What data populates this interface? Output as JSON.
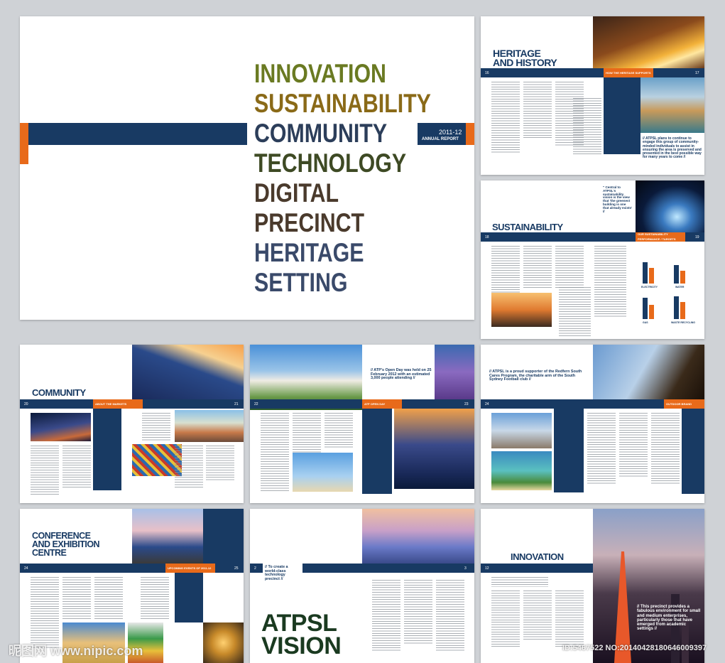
{
  "cover": {
    "words": [
      "INNOVATION",
      "SUSTAINABILITY",
      "COMMUNITY",
      "TECHNOLOGY",
      "DIGITAL PRECINCT",
      "HERITAGE SETTING"
    ],
    "year": "2011-12",
    "report": "ANNUAL REPORT"
  },
  "heritage": {
    "title_1": "HERITAGE",
    "title_2": "AND HISTORY",
    "page_left": "16",
    "page_right": "17",
    "orange_label": "HOW THE HERITAGE SUPPORTS US",
    "quote": "// ATPSL plans to continue to engage this group of community-minded individuals to assist in ensuring the area is preserved and presented in the best possible way for many years to come //"
  },
  "sustainability": {
    "title": "SUSTAINABILITY",
    "page_left": "18",
    "page_right": "19",
    "quote": "\" Central to ATPSL's sustainability vision is the view that 'the greenest building is one that already exists' //",
    "orange_label": "OUR SUSTAINABILITY PERFORMANCE / TARGETS",
    "chart_labels": [
      "ELECTRICITY",
      "WATER",
      "GAS",
      "WASTE RECYCLING"
    ]
  },
  "community": {
    "title": "COMMUNITY",
    "page_left": "20",
    "page_right": "21",
    "orange_label": "ABOUT THE MARKETS"
  },
  "openday": {
    "page_left": "22",
    "page_right": "23",
    "quote": "// ATP's Open Day was held on 25 February 2012 with an estimated 3,000 people attending //",
    "orange_label": "ATP OPEN DAY"
  },
  "football": {
    "page_left": "24",
    "page_right": "25",
    "quote": "// ATPSL is a proud supporter of the Redfern South Cares Program, the charitable arm of the South Sydney Football club //",
    "orange_label": "OUTDOOR BRAND"
  },
  "conference": {
    "title_1": "CONFERENCE",
    "title_2": "AND EXHIBITION",
    "title_3": "CENTRE",
    "page_left": "24",
    "page_right": "25",
    "orange_label": "UPCOMING EVENTS OF 2011-12"
  },
  "vision": {
    "page_left": "2",
    "page_right": "3",
    "quote": "// To create a world-class technology precinct //",
    "title_1": "ATPSL",
    "title_2": "VISION"
  },
  "innovation": {
    "title": "INNOVATION",
    "page_left": "12",
    "page_right": "13",
    "quote": "// This precinct provides a fabulous environment for small and medium enterprises, particularly those that have emerged from academic settings //"
  },
  "watermark": {
    "logo": "昵图网 www.nipic.com",
    "id": "ID:5467522 NO:20140428180646009397"
  },
  "colors": {
    "navy": "#183a63",
    "orange": "#e86a1a"
  }
}
